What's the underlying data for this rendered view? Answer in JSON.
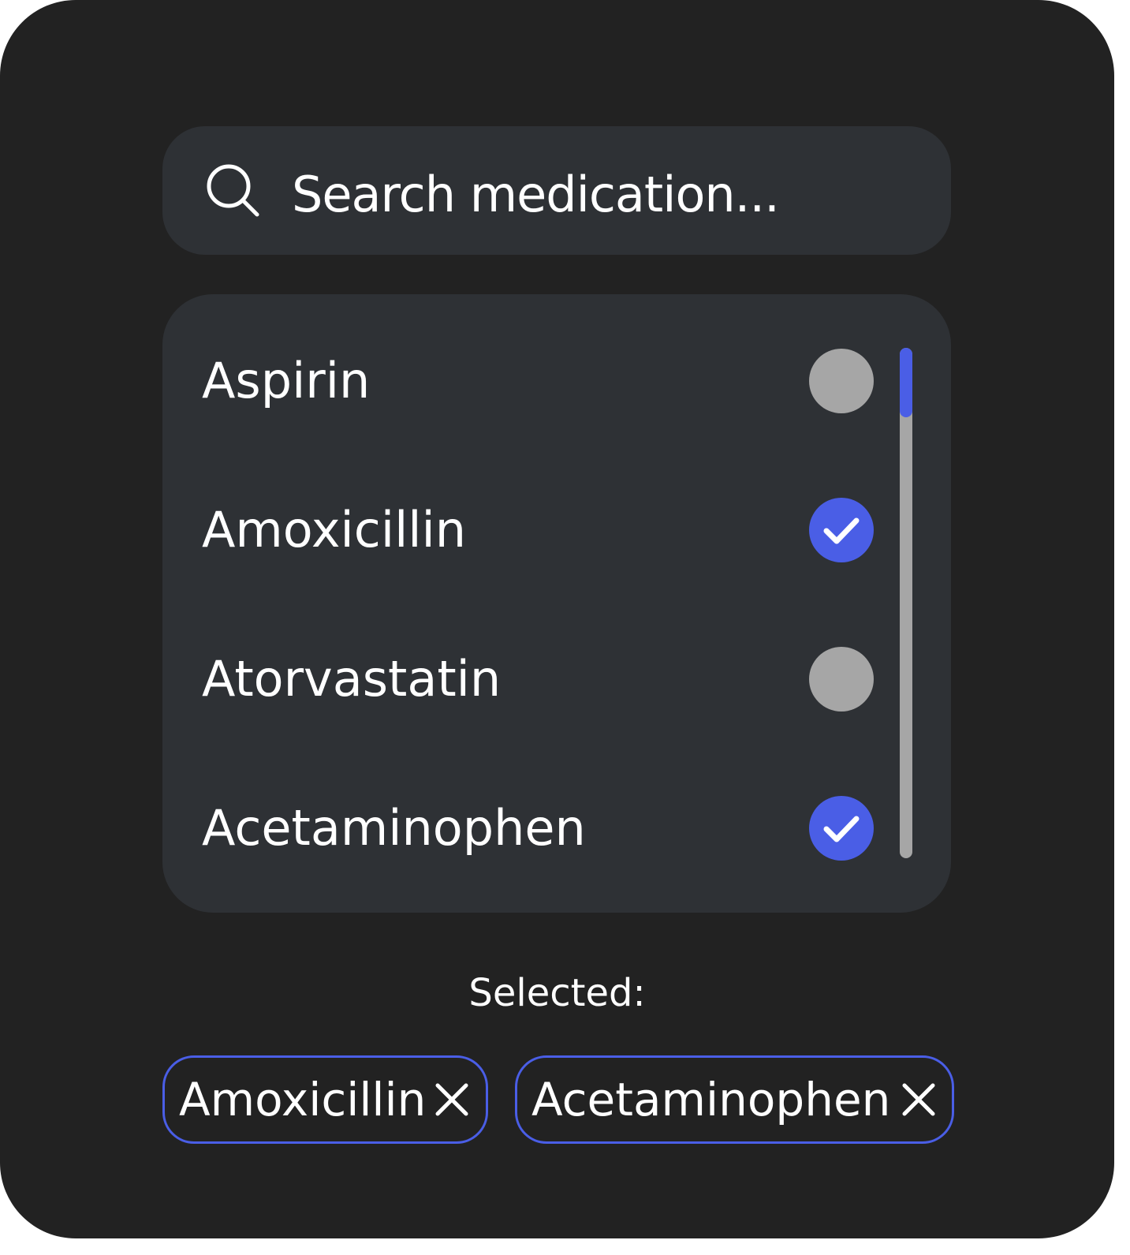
{
  "search": {
    "placeholder": "Search medication...",
    "icon": "search-icon"
  },
  "list": {
    "items": [
      {
        "label": "Aspirin",
        "selected": false
      },
      {
        "label": "Amoxicillin",
        "selected": true
      },
      {
        "label": "Atorvastatin",
        "selected": false
      },
      {
        "label": "Acetaminophen",
        "selected": true
      }
    ]
  },
  "selected": {
    "heading": "Selected:",
    "chips": [
      {
        "label": "Amoxicillin",
        "icon": "close-icon"
      },
      {
        "label": "Acetaminophen",
        "icon": "close-icon"
      }
    ]
  },
  "colors": {
    "background": "#222222",
    "card": "#2e3135",
    "accent": "#4a5ee6",
    "unchecked": "#a6a6a6",
    "text": "#ffffff"
  }
}
